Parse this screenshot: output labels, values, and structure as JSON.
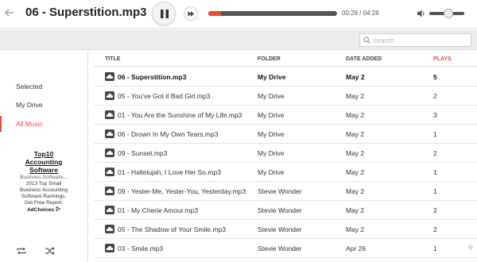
{
  "player": {
    "track_title": "06 - Superstition.mp3",
    "time": "00:26 / 04:26",
    "progress": 0.1,
    "volume": 0.55,
    "icons": {
      "back": "back-arrow-icon",
      "pause": "pause-icon",
      "next": "next-track-icon",
      "volume": "volume-icon"
    }
  },
  "search": {
    "placeholder": "search"
  },
  "sidebar": {
    "items": [
      {
        "label": "Selected",
        "active": false
      },
      {
        "label": "My Drive",
        "active": false
      },
      {
        "label": "All Music",
        "active": true
      }
    ],
    "ad": {
      "title_line1": "Top10",
      "title_line2": "Accounting",
      "title_line3": "Software",
      "url": "Business-Software...",
      "body_line1": "2013 Top Small",
      "body_line2": "Business Accounting",
      "body_line3": "Software Rankings.",
      "body_line4": "Get Free Report.",
      "choices": "AdChoices"
    },
    "controls": [
      "repeat-icon",
      "shuffle-icon"
    ]
  },
  "table": {
    "headers": {
      "title": "TITLE",
      "folder": "FOLDER",
      "date_added": "DATE ADDED",
      "plays": "PLAYS"
    },
    "accent_color": "#e84c3d",
    "rows": [
      {
        "title": "06 - Superstition.mp3",
        "folder": "My Drive",
        "date": "May 2",
        "plays": "5",
        "current": true
      },
      {
        "title": "05 - You've Got it Bad Girl.mp3",
        "folder": "My Drive",
        "date": "May 2",
        "plays": "2",
        "current": false
      },
      {
        "title": "01 - You Are the Sunshine of My Life.mp3",
        "folder": "My Drive",
        "date": "May 2",
        "plays": "3",
        "current": false
      },
      {
        "title": "06 - Drown In My Own Tears.mp3",
        "folder": "My Drive",
        "date": "May 2",
        "plays": "1",
        "current": false
      },
      {
        "title": "09 - Sunset.mp3",
        "folder": "My Drive",
        "date": "May 2",
        "plays": "2",
        "current": false
      },
      {
        "title": "01 - Hallelujah, I Love Her So.mp3",
        "folder": "My Drive",
        "date": "May 2",
        "plays": "1",
        "current": false
      },
      {
        "title": "09 - Yester-Me, Yester-You, Yesterday.mp3",
        "folder": "Stevie Wonder",
        "date": "May 2",
        "plays": "1",
        "current": false
      },
      {
        "title": "01 - My Cherie Amour.mp3",
        "folder": "Stevie Wonder",
        "date": "May 2",
        "plays": "2",
        "current": false
      },
      {
        "title": "05 - The Shadow of Your Smile.mp3",
        "folder": "Stevie Wonder",
        "date": "May 2",
        "plays": "2",
        "current": false
      },
      {
        "title": "03 - Smile.mp3",
        "folder": "Stevie Wonder",
        "date": "Apr 26",
        "plays": "1",
        "current": false
      }
    ]
  }
}
